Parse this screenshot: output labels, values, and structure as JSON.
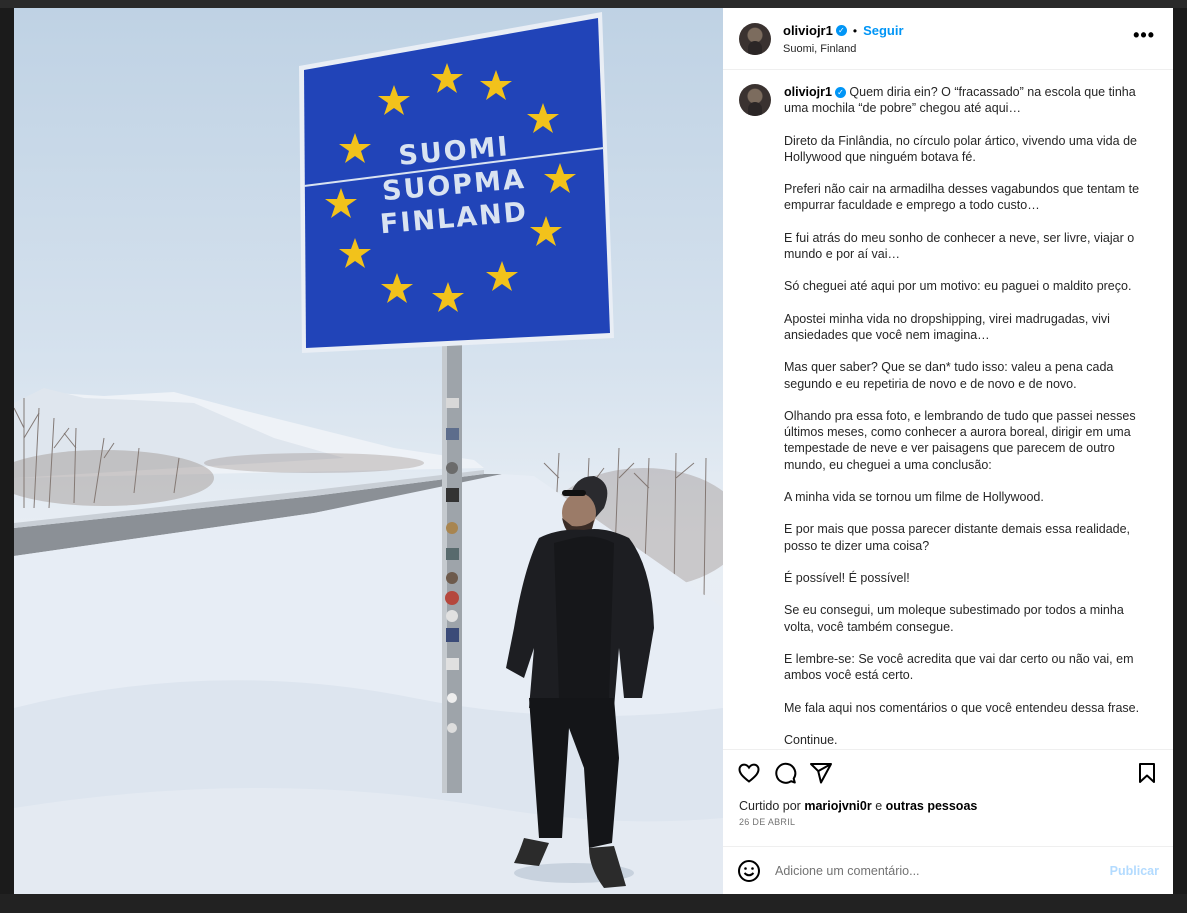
{
  "post": {
    "username": "oliviojr1",
    "follow_label": "Seguir",
    "location": "Suomi, Finland",
    "more_label": "•••",
    "sign_lines": [
      "SUOMI",
      "SUOPMA",
      "FINLAND"
    ],
    "caption_first": "Quem diria ein? O “fracassado” na escola que tinha uma mochila “de pobre” chegou até aqui…",
    "caption_paragraphs": [
      "Direto da Finlândia, no círculo polar ártico, vivendo uma vida de Hollywood que ninguém botava fé.",
      "Preferi não cair na armadilha desses vagabundos que tentam te empurrar faculdade e emprego a todo custo…",
      "E fui atrás do meu sonho de conhecer a neve, ser livre, viajar o mundo e por aí vai…",
      "Só cheguei até aqui por um motivo: eu paguei o maldito preço.",
      "Apostei minha vida no dropshipping, virei madrugadas, vivi ansiedades que você nem imagina…",
      "Mas quer saber? Que se dan* tudo isso: valeu a pena cada segundo e eu repetiria de novo e de novo e de novo.",
      "Olhando pra essa foto, e lembrando de tudo que passei nesses últimos meses, como conhecer a aurora boreal, dirigir em uma tempestade de neve e ver paisagens que parecem de outro mundo, eu cheguei a uma conclusão:",
      "A minha vida se tornou um filme de Hollywood.",
      "E por mais que possa parecer distante demais essa realidade, posso te dizer uma coisa?",
      "É possível! É possível!",
      "Se eu consegui, um moleque subestimado por todos a minha volta, você também consegue.",
      "E lembre-se: Se você acredita que vai dar certo ou não vai, em ambos você está certo.",
      "Me fala aqui nos comentários o que você entendeu dessa frase.",
      "Continue."
    ],
    "liked_prefix": "Curtido por",
    "liked_user": "mariojvni0r",
    "liked_suffix": "e",
    "liked_others": "outras pessoas",
    "date": "26 DE ABRIL",
    "comment_placeholder": "Adicione um comentário...",
    "publish_label": "Publicar"
  },
  "icons": [
    "heart-icon",
    "comment-icon",
    "share-icon",
    "bookmark-icon",
    "emoji-icon",
    "verified-badge-icon"
  ],
  "colors": {
    "accent": "#0095f6",
    "publish_disabled": "#b3dbff",
    "sign_blue": "#2144b8",
    "star": "#f2c21b"
  }
}
